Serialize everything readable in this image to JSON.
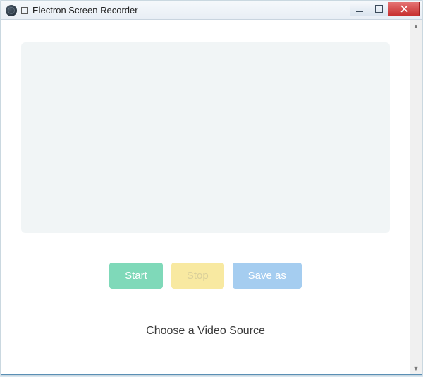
{
  "window": {
    "title": "Electron Screen Recorder"
  },
  "buttons": {
    "start": "Start",
    "stop": "Stop",
    "saveas": "Save as"
  },
  "source_link": "Choose a Video Source"
}
